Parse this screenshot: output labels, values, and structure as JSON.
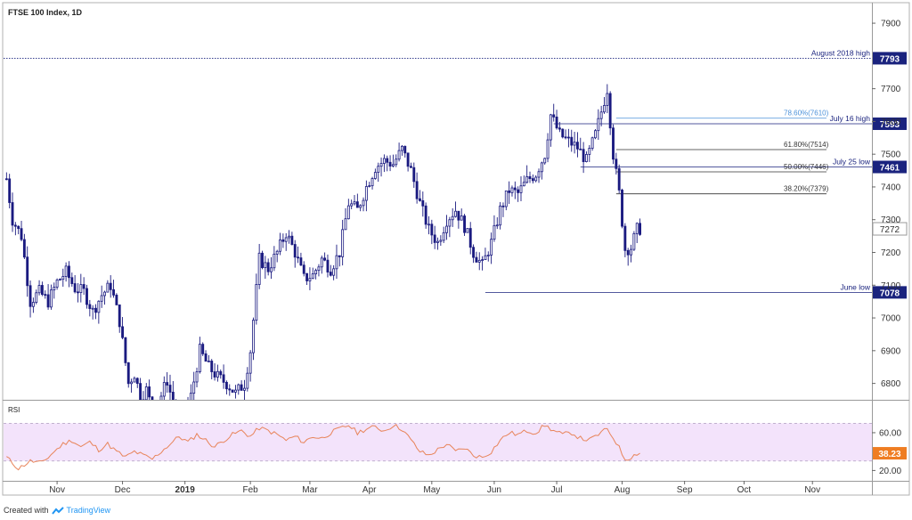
{
  "chart_data": {
    "type": "candlestick",
    "title": "FTSE 100 Index, 1D",
    "price_axis": {
      "ylim": [
        6750,
        7960
      ],
      "ticks": [
        6800,
        6900,
        7000,
        7100,
        7200,
        7300,
        7400,
        7500,
        7600,
        7700,
        7900
      ]
    },
    "x_axis": {
      "ticks": [
        {
          "label": "Nov",
          "x": 1
        },
        {
          "label": "Dec",
          "x": 23
        },
        {
          "label": "2019",
          "x": 44
        },
        {
          "label": "Feb",
          "x": 66
        },
        {
          "label": "Mar",
          "x": 86
        },
        {
          "label": "Apr",
          "x": 106
        },
        {
          "label": "May",
          "x": 127
        },
        {
          "label": "Jun",
          "x": 148
        },
        {
          "label": "Jul",
          "x": 169
        },
        {
          "label": "Aug",
          "x": 191
        },
        {
          "label": "Sep",
          "x": 212
        },
        {
          "label": "Oct",
          "x": 232
        },
        {
          "label": "Nov",
          "x": 255
        }
      ],
      "xlim": [
        -17,
        275
      ]
    },
    "levels": [
      {
        "label": "August 2018 high",
        "badge": "7793",
        "value": 7793,
        "color": "#1a237e",
        "style": "dotted",
        "x_start": -17
      },
      {
        "label": "July 16 high",
        "badge": "7593",
        "value": 7593,
        "color": "#1a237e",
        "style": "solid",
        "x_start": 168
      },
      {
        "label": "July 25 low",
        "badge": "7461",
        "value": 7461,
        "color": "#1a237e",
        "style": "solid",
        "x_start": 177
      },
      {
        "label": "June low",
        "badge": "7078",
        "value": 7078,
        "color": "#1a237e",
        "style": "solid",
        "x_start": 145
      }
    ],
    "fibs": [
      {
        "label": "78.60%(7610)",
        "value": 7610,
        "color": "#4a90d9"
      },
      {
        "label": "61.80%(7514)",
        "value": 7514,
        "color": "#333333"
      },
      {
        "label": "50.00%(7446)",
        "value": 7446,
        "color": "#333333"
      },
      {
        "label": "38.20%(7379)",
        "value": 7379,
        "color": "#333333"
      }
    ],
    "fib_x_start": 189,
    "last_price": {
      "badge": "7272",
      "value": 7272
    },
    "colors": {
      "up": "#ffffff",
      "down": "#1a1a80",
      "wick": "#1a1a80",
      "rsi_line": "#e8845a",
      "rsi_band": "#f3e3fb",
      "level_badge": "#1a237e",
      "rsi_badge": "#ef7d22"
    },
    "candles": {
      "x_start": -16,
      "anchors": [
        [
          -16,
          7425
        ],
        [
          -14,
          7300
        ],
        [
          -11,
          7250
        ],
        [
          -8,
          7050
        ],
        [
          -5,
          7080
        ],
        [
          -2,
          7050
        ],
        [
          1,
          7110
        ],
        [
          4,
          7140
        ],
        [
          7,
          7090
        ],
        [
          10,
          7080
        ],
        [
          13,
          7020
        ],
        [
          16,
          7070
        ],
        [
          19,
          7100
        ],
        [
          22,
          6990
        ],
        [
          25,
          6800
        ],
        [
          27,
          6830
        ],
        [
          29,
          6760
        ],
        [
          31,
          6780
        ],
        [
          33,
          6720
        ],
        [
          35,
          6740
        ],
        [
          38,
          6810
        ],
        [
          41,
          6700
        ],
        [
          43,
          6680
        ],
        [
          46,
          6760
        ],
        [
          49,
          6900
        ],
        [
          52,
          6850
        ],
        [
          55,
          6820
        ],
        [
          58,
          6800
        ],
        [
          61,
          6770
        ],
        [
          64,
          6800
        ],
        [
          66,
          6900
        ],
        [
          69,
          7180
        ],
        [
          72,
          7150
        ],
        [
          75,
          7200
        ],
        [
          78,
          7260
        ],
        [
          81,
          7200
        ],
        [
          84,
          7120
        ],
        [
          87,
          7130
        ],
        [
          90,
          7180
        ],
        [
          93,
          7150
        ],
        [
          96,
          7200
        ],
        [
          99,
          7350
        ],
        [
          102,
          7330
        ],
        [
          105,
          7400
        ],
        [
          108,
          7460
        ],
        [
          111,
          7480
        ],
        [
          114,
          7470
        ],
        [
          117,
          7515
        ],
        [
          120,
          7450
        ],
        [
          123,
          7350
        ],
        [
          126,
          7270
        ],
        [
          129,
          7230
        ],
        [
          132,
          7300
        ],
        [
          135,
          7330
        ],
        [
          138,
          7280
        ],
        [
          141,
          7200
        ],
        [
          144,
          7160
        ],
        [
          147,
          7230
        ],
        [
          150,
          7330
        ],
        [
          153,
          7390
        ],
        [
          156,
          7380
        ],
        [
          159,
          7420
        ],
        [
          162,
          7440
        ],
        [
          165,
          7500
        ],
        [
          167,
          7620
        ],
        [
          170,
          7560
        ],
        [
          173,
          7540
        ],
        [
          176,
          7520
        ],
        [
          179,
          7480
        ],
        [
          182,
          7560
        ],
        [
          184,
          7630
        ],
        [
          186,
          7700
        ],
        [
          188,
          7500
        ],
        [
          190,
          7380
        ],
        [
          192,
          7210
        ],
        [
          194,
          7215
        ],
        [
          196,
          7270
        ],
        [
          197,
          7272
        ]
      ]
    },
    "rsi": {
      "label": "RSI",
      "badge": "38.23",
      "value": 38.23,
      "ylim": [
        10,
        92
      ],
      "bands": [
        30,
        70
      ],
      "ticks": [
        {
          "label": "60.00",
          "value": 60
        },
        {
          "label": "20.00",
          "value": 20
        }
      ],
      "anchors": [
        [
          -16,
          34
        ],
        [
          -12,
          22
        ],
        [
          -8,
          30
        ],
        [
          -4,
          28
        ],
        [
          0,
          40
        ],
        [
          3,
          48
        ],
        [
          6,
          52
        ],
        [
          9,
          45
        ],
        [
          12,
          50
        ],
        [
          15,
          42
        ],
        [
          18,
          48
        ],
        [
          21,
          40
        ],
        [
          24,
          34
        ],
        [
          27,
          40
        ],
        [
          30,
          36
        ],
        [
          33,
          32
        ],
        [
          36,
          40
        ],
        [
          39,
          48
        ],
        [
          42,
          56
        ],
        [
          45,
          50
        ],
        [
          48,
          58
        ],
        [
          51,
          52
        ],
        [
          54,
          45
        ],
        [
          57,
          52
        ],
        [
          60,
          58
        ],
        [
          63,
          62
        ],
        [
          66,
          56
        ],
        [
          69,
          65
        ],
        [
          72,
          62
        ],
        [
          75,
          58
        ],
        [
          78,
          52
        ],
        [
          81,
          56
        ],
        [
          84,
          50
        ],
        [
          87,
          56
        ],
        [
          90,
          54
        ],
        [
          93,
          60
        ],
        [
          96,
          64
        ],
        [
          99,
          68
        ],
        [
          102,
          60
        ],
        [
          105,
          64
        ],
        [
          108,
          66
        ],
        [
          111,
          62
        ],
        [
          114,
          68
        ],
        [
          117,
          64
        ],
        [
          120,
          52
        ],
        [
          123,
          40
        ],
        [
          126,
          36
        ],
        [
          129,
          42
        ],
        [
          132,
          48
        ],
        [
          135,
          40
        ],
        [
          138,
          44
        ],
        [
          141,
          36
        ],
        [
          144,
          34
        ],
        [
          147,
          40
        ],
        [
          150,
          52
        ],
        [
          153,
          60
        ],
        [
          156,
          58
        ],
        [
          159,
          62
        ],
        [
          162,
          60
        ],
        [
          165,
          68
        ],
        [
          168,
          62
        ],
        [
          171,
          58
        ],
        [
          174,
          60
        ],
        [
          177,
          54
        ],
        [
          180,
          52
        ],
        [
          183,
          58
        ],
        [
          186,
          64
        ],
        [
          189,
          50
        ],
        [
          192,
          32
        ],
        [
          194,
          34
        ],
        [
          196,
          38
        ],
        [
          197,
          38.23
        ]
      ]
    }
  },
  "footer": {
    "text": "Created with",
    "brand": "TradingView"
  }
}
